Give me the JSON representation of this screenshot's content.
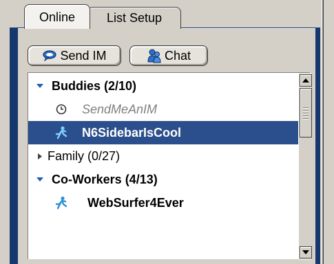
{
  "tabs": [
    {
      "label": "Online",
      "selected": true
    },
    {
      "label": "List Setup",
      "selected": false
    }
  ],
  "toolbar": {
    "send_im_label": "Send IM",
    "send_im_icon": "speech-bubble-icon",
    "chat_label": "Chat",
    "chat_icon": "people-icon"
  },
  "buddy_list": {
    "groups": [
      {
        "label": "Buddies (2/10)",
        "expanded": true
      },
      {
        "label": "Family (0/27)",
        "expanded": false
      },
      {
        "label": "Co-Workers (4/13)",
        "expanded": true
      }
    ],
    "buddies": [
      {
        "name": "SendMeAnIM",
        "status": "away",
        "icon": "clock-icon"
      },
      {
        "name": "N6SidebarIsCool",
        "status": "online",
        "icon": "running-man-icon",
        "selected": true
      },
      {
        "name": "WebSurfer4Ever",
        "status": "online",
        "icon": "running-man-icon"
      }
    ]
  },
  "colors": {
    "selection": "#2b4f8c",
    "frame": "#17386e",
    "away_text": "#808080",
    "buddy_icon": "#2a8fd6"
  }
}
